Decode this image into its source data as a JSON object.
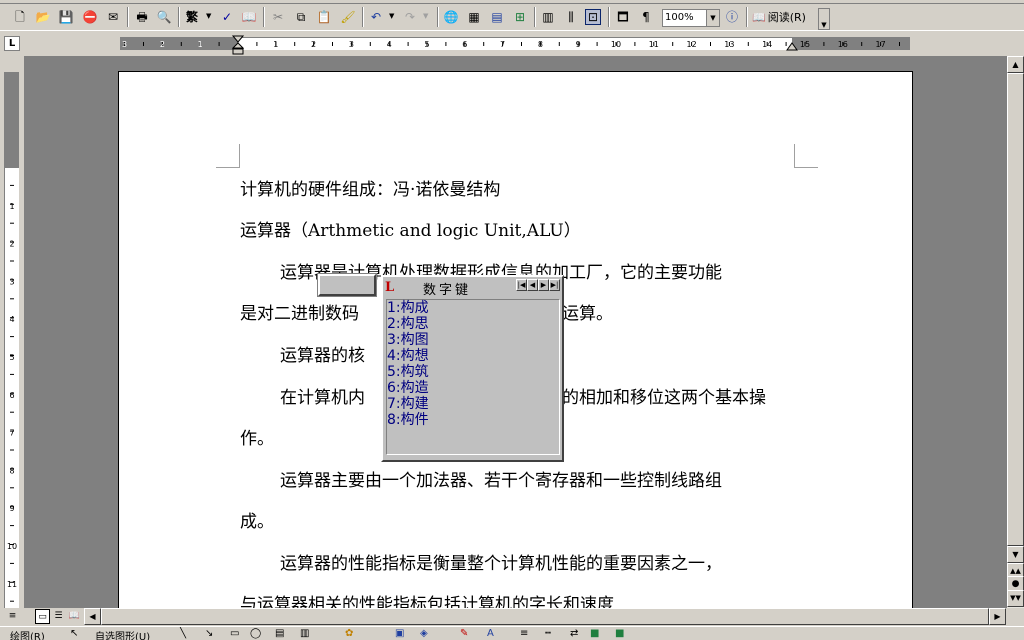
{
  "toolbar": {
    "zoom": "100%",
    "read_label": "阅读(R)"
  },
  "document": {
    "lines": [
      "计算机的硬件组成：冯·诺依曼结构",
      "运算器（Arthmetic and logic Unit,ALU）",
      "运算器是计算机处理数据形成信息的加工厂，它的主要功能",
      "是对二进制数码",
      "运算。",
      "运算器的核",
      "在计算机内",
      "的相加和移位这两个基本操",
      "作。",
      "运算器主要由一个加法器、若干个寄存器和一些控制线路组",
      "成。",
      "运算器的性能指标是衡量整个计算机性能的重要因素之一，",
      "与运算器相关的性能指标包括计算机的字长和速度"
    ]
  },
  "ime": {
    "mode": "数字键",
    "candidates": [
      "1:构成",
      "2:构思",
      "3:构图",
      "4:构想",
      "5:构筑",
      "6:构造",
      "7:构建",
      "8:构件"
    ]
  },
  "drawbar": {
    "draw_label": "绘图(R)",
    "autoshapes_label": "自选图形(U)"
  },
  "ruler": {
    "h_labels": [
      "3",
      "2",
      "1",
      "1",
      "2",
      "3",
      "4",
      "5",
      "6",
      "7",
      "8",
      "9",
      "10",
      "11",
      "12",
      "13",
      "14",
      "15",
      "16",
      "17"
    ],
    "v_labels": [
      "2",
      "1",
      "1",
      "2",
      "3",
      "4",
      "5",
      "6",
      "7",
      "8",
      "9",
      "10",
      "11"
    ]
  }
}
